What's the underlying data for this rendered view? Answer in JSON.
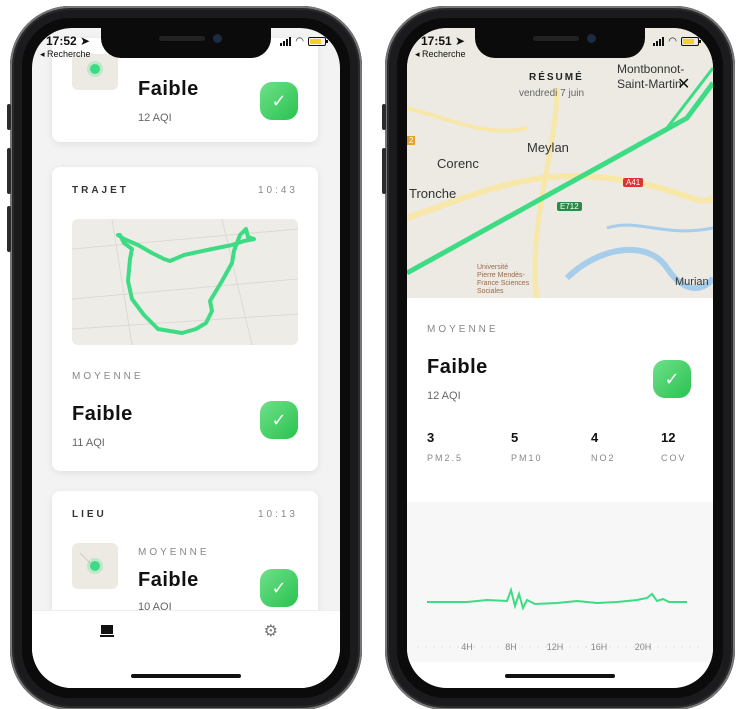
{
  "left_phone": {
    "status": {
      "time": "17:52",
      "back": "◂ Recherche"
    },
    "top_card": {
      "level": "Faible",
      "aqi": "12 AQI"
    },
    "trip_card": {
      "title": "TRAJET",
      "time": "10:43",
      "avg_label": "MOYENNE",
      "level": "Faible",
      "aqi": "11 AQI"
    },
    "place_card": {
      "title": "LIEU",
      "time": "10:13",
      "avg_label": "MOYENNE",
      "level": "Faible",
      "aqi": "10 AQI"
    },
    "tabbar": {
      "tab1_icon": "laptop-icon",
      "tab2_icon": "gear-icon"
    }
  },
  "right_phone": {
    "status": {
      "time": "17:51",
      "back": "◂ Recherche"
    },
    "map": {
      "summary": "RÉSUMÉ",
      "date": "vendredi 7 juin",
      "places": [
        "Montbonnot-",
        "Saint-Martin",
        "Meylan",
        "Corenc",
        "Tronche",
        "Murian",
        "Université",
        "Pierre Mendès-",
        "France Sciences",
        "Sociales"
      ],
      "road_a41": "A41",
      "road_e712": "E712",
      "road_2": "2",
      "close": "✕"
    },
    "detail": {
      "avg_label": "MOYENNE",
      "level": "Faible",
      "aqi": "12 AQI",
      "metrics": [
        {
          "value": "3",
          "name": "PM2.5"
        },
        {
          "value": "5",
          "name": "PM10"
        },
        {
          "value": "4",
          "name": "NO2"
        },
        {
          "value": "12",
          "name": "COV"
        }
      ]
    },
    "chart_data": {
      "type": "line",
      "categories": [
        "4H",
        "8H",
        "12H",
        "16H",
        "20H"
      ]
    }
  },
  "colors": {
    "accent": "#2ecc71",
    "track": "#3ddc84",
    "map_bg": "#eceae3"
  }
}
